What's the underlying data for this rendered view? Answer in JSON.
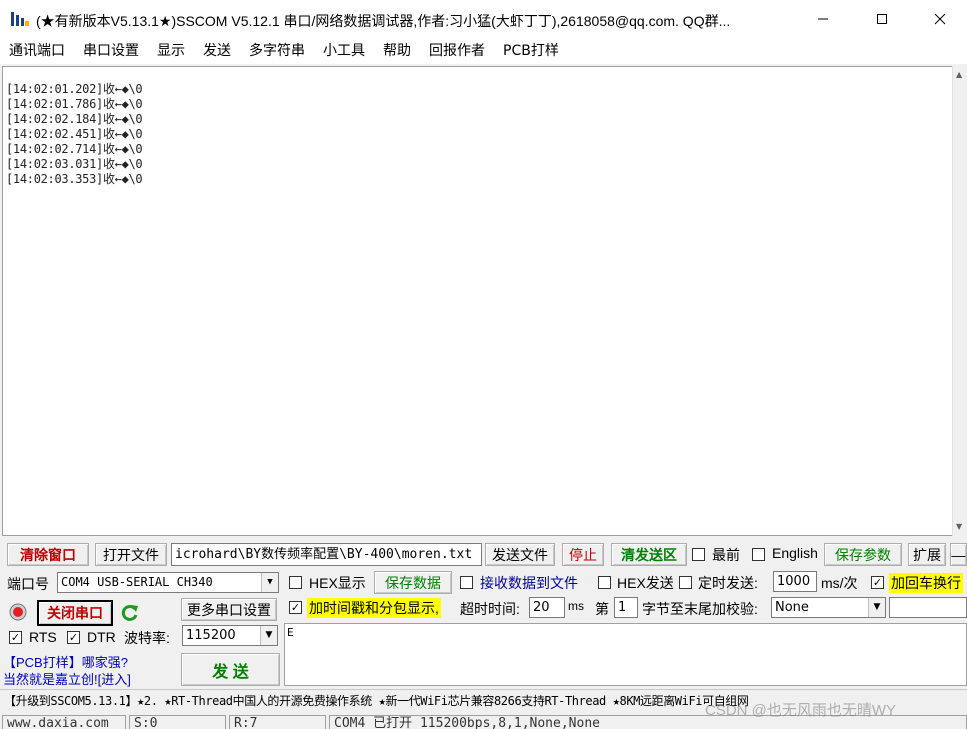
{
  "window": {
    "title": "(★有新版本V5.13.1★)SSCOM V5.12.1 串口/网络数据调试器,作者:习小猛(大虾丁丁),2618058@qq.com. QQ群..."
  },
  "menu": [
    "通讯端口",
    "串口设置",
    "显示",
    "发送",
    "多字符串",
    "小工具",
    "帮助",
    "回报作者",
    "PCB打样"
  ],
  "receive": {
    "lines": [
      "[14:02:01.202]收←◆\\0",
      "[14:02:01.786]收←◆\\0",
      "[14:02:02.184]收←◆\\0",
      "[14:02:02.451]收←◆\\0",
      "[14:02:02.714]收←◆\\0",
      "[14:02:03.031]收←◆\\0",
      "[14:02:03.353]收←◆\\0"
    ]
  },
  "toolbar": {
    "clear_window": "清除窗口",
    "open_file": "打开文件",
    "file_path": "icrohard\\BY数传频率配置\\BY-400\\moren.txt",
    "send_file": "发送文件",
    "stop": "停止",
    "clear_send": "清发送区",
    "topmost": "最前",
    "english": "English",
    "save_params": "保存参数",
    "expand": "扩展",
    "collapse": "—"
  },
  "port": {
    "port_label": "端口号",
    "port_value": "COM4 USB-SERIAL CH340",
    "close_port": "关闭串口",
    "more_settings": "更多串口设置",
    "rts": "RTS",
    "dtr": "DTR",
    "baud_label": "波特率:",
    "baud_value": "115200",
    "promo_line1": "【PCB打样】哪家强?",
    "promo_line2": "当然就是嘉立创![进入]",
    "send": "发  送"
  },
  "options": {
    "hex_display": "HEX显示",
    "save_data": "保存数据",
    "recv_to_file": "接收数据到文件",
    "hex_send": "HEX发送",
    "timed_send": "定时发送:",
    "timed_interval": "1000",
    "timed_unit": "ms/次",
    "crlf": "加回车换行",
    "timestamp": "加时间戳和分包显示,",
    "timeout_label": "超时时间:",
    "timeout_value": "20",
    "timeout_unit": "ms",
    "byte_prefix": "第",
    "byte_index": "1",
    "byte_suffix": "字节至末尾加校验:",
    "checksum": "None"
  },
  "send_area": {
    "text": "E"
  },
  "promo_bar": "【升级到SSCOM5.13.1】★2. ★RT-Thread中国人的开源免费操作系统 ★新一代WiFi芯片兼容8266支持RT-Thread ★8KM远距离WiFi可自组网",
  "statusbar": {
    "website": "www.daxia.com",
    "sent": "S:0",
    "received": "R:7",
    "status": "COM4 已打开  115200bps,8,1,None,None"
  },
  "watermark": "CSDN @也无风雨也无晴WY"
}
